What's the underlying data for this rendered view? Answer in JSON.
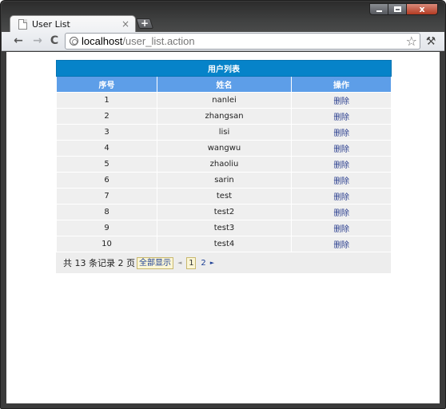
{
  "browser": {
    "tab_title": "User List",
    "tab_close": "×",
    "new_tab": "+",
    "url_host": "localhost",
    "url_path": "/user_list.action",
    "back": "←",
    "forward": "→",
    "reload": "C",
    "star": "☆",
    "wrench": "🔧",
    "win_close": "x"
  },
  "table": {
    "caption": "用户列表",
    "columns": [
      "序号",
      "姓名",
      "操作"
    ],
    "rows": [
      {
        "no": "1",
        "name": "nanlei",
        "action": "删除"
      },
      {
        "no": "2",
        "name": "zhangsan",
        "action": "删除"
      },
      {
        "no": "3",
        "name": "lisi",
        "action": "删除"
      },
      {
        "no": "4",
        "name": "wangwu",
        "action": "删除"
      },
      {
        "no": "5",
        "name": "zhaoliu",
        "action": "删除"
      },
      {
        "no": "6",
        "name": "sarin",
        "action": "删除"
      },
      {
        "no": "7",
        "name": "test",
        "action": "删除"
      },
      {
        "no": "8",
        "name": "test2",
        "action": "删除"
      },
      {
        "no": "9",
        "name": "test3",
        "action": "删除"
      },
      {
        "no": "10",
        "name": "test4",
        "action": "删除"
      }
    ]
  },
  "pager": {
    "summary": "共 13 条记录 2 页",
    "show_all": "全部显示",
    "prev": "◄",
    "current": "1",
    "next_page": "2",
    "next": "►"
  },
  "colors": {
    "caption_bg": "#0683c9",
    "header_bg": "#5d9ee8",
    "row_bg": "#efefef",
    "link": "#2b3f8f"
  }
}
